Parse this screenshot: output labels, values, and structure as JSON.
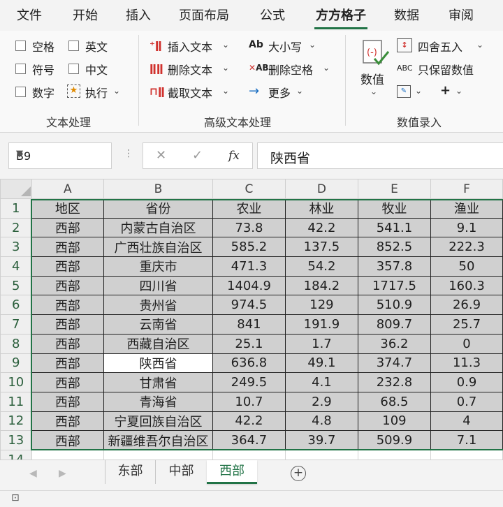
{
  "menu": {
    "tabs": [
      {
        "label": "文件"
      },
      {
        "label": "开始"
      },
      {
        "label": "插入"
      },
      {
        "label": "页面布局"
      },
      {
        "label": "公式"
      },
      {
        "label": "方方格子",
        "active": true
      },
      {
        "label": "数据"
      },
      {
        "label": "审阅"
      }
    ]
  },
  "ribbon": {
    "text_group": {
      "checks": [
        {
          "label": "空格"
        },
        {
          "label": "英文"
        },
        {
          "label": "符号"
        },
        {
          "label": "中文"
        },
        {
          "label": "数字"
        }
      ],
      "execute_label": "执行",
      "group_label": "文本处理"
    },
    "advanced_group": {
      "insert_text": "插入文本",
      "delete_text": "删除文本",
      "extract_text": "截取文本",
      "case": "大小写",
      "delete_spaces": "删除空格",
      "more": "更多",
      "group_label": "高级文本处理",
      "ab_icon_text": "Ab",
      "ab_icon_text2": "AB"
    },
    "numeric_group": {
      "value_label": "数值",
      "round_label": "四舍五入",
      "keep_values_label": "只保留数值",
      "abc_icon_text": "ABC",
      "group_label": "数值录入"
    }
  },
  "formula_bar": {
    "name_box": "B9",
    "fx_label": "fx",
    "value": "陕西省"
  },
  "sheet": {
    "column_headers": [
      "A",
      "B",
      "C",
      "D",
      "E",
      "F"
    ],
    "row_numbers": [
      "1",
      "2",
      "3",
      "4",
      "5",
      "6",
      "7",
      "8",
      "9",
      "10",
      "11",
      "12",
      "13",
      "14"
    ],
    "rows": [
      [
        "地区",
        "省份",
        "农业",
        "林业",
        "牧业",
        "渔业"
      ],
      [
        "西部",
        "内蒙古自治区",
        "73.8",
        "42.2",
        "541.1",
        "9.1"
      ],
      [
        "西部",
        "广西壮族自治区",
        "585.2",
        "137.5",
        "852.5",
        "222.3"
      ],
      [
        "西部",
        "重庆市",
        "471.3",
        "54.2",
        "357.8",
        "50"
      ],
      [
        "西部",
        "四川省",
        "1404.9",
        "184.2",
        "1717.5",
        "160.3"
      ],
      [
        "西部",
        "贵州省",
        "974.5",
        "129",
        "510.9",
        "26.9"
      ],
      [
        "西部",
        "云南省",
        "841",
        "191.9",
        "809.7",
        "25.7"
      ],
      [
        "西部",
        "西藏自治区",
        "25.1",
        "1.7",
        "36.2",
        "0"
      ],
      [
        "西部",
        "陕西省",
        "636.8",
        "49.1",
        "374.7",
        "11.3"
      ],
      [
        "西部",
        "甘肃省",
        "249.5",
        "4.1",
        "232.8",
        "0.9"
      ],
      [
        "西部",
        "青海省",
        "10.7",
        "2.9",
        "68.5",
        "0.7"
      ],
      [
        "西部",
        "宁夏回族自治区",
        "42.2",
        "4.8",
        "109",
        "4"
      ],
      [
        "西部",
        "新疆维吾尔自治区",
        "364.7",
        "39.7",
        "509.9",
        "7.1"
      ]
    ],
    "active_cell": "B9"
  },
  "sheet_tabs": {
    "tabs": [
      {
        "label": "东部"
      },
      {
        "label": "中部"
      },
      {
        "label": "西部",
        "active": true
      }
    ]
  }
}
